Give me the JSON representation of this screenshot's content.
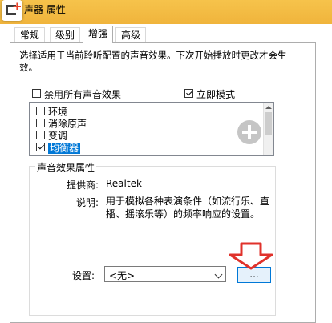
{
  "window": {
    "title": "声器 属性"
  },
  "tabs": [
    {
      "label": "常规"
    },
    {
      "label": "级别"
    },
    {
      "label": "增强",
      "active": true
    },
    {
      "label": "高级"
    }
  ],
  "description": "选择适用于当前聆听配置的声音效果。下次开始播放时更改才会生效。",
  "options": {
    "disable_all": {
      "label": "禁用所有声音效果",
      "checked": false
    },
    "immediate_mode": {
      "label": "立即模式",
      "checked": true
    }
  },
  "effects": [
    {
      "label": "环境",
      "checked": false
    },
    {
      "label": "消除原声",
      "checked": false
    },
    {
      "label": "变调",
      "checked": false
    },
    {
      "label": "均衡器",
      "checked": true,
      "selected": true
    }
  ],
  "properties": {
    "group_title": "声音效果属性",
    "provider_label": "提供商:",
    "provider_value": "Realtek",
    "description_label": "说明:",
    "description_value": "用于模拟各种表演条件（如流行乐、直播、摇滚乐等）的频率响应的设置。",
    "setting_label": "设置:",
    "setting_value": "<无>",
    "browse_button": "..."
  },
  "colors": {
    "titlebar": "#f0b43c",
    "selection": "#0078d7",
    "annotation_arrow": "#e0322b"
  }
}
